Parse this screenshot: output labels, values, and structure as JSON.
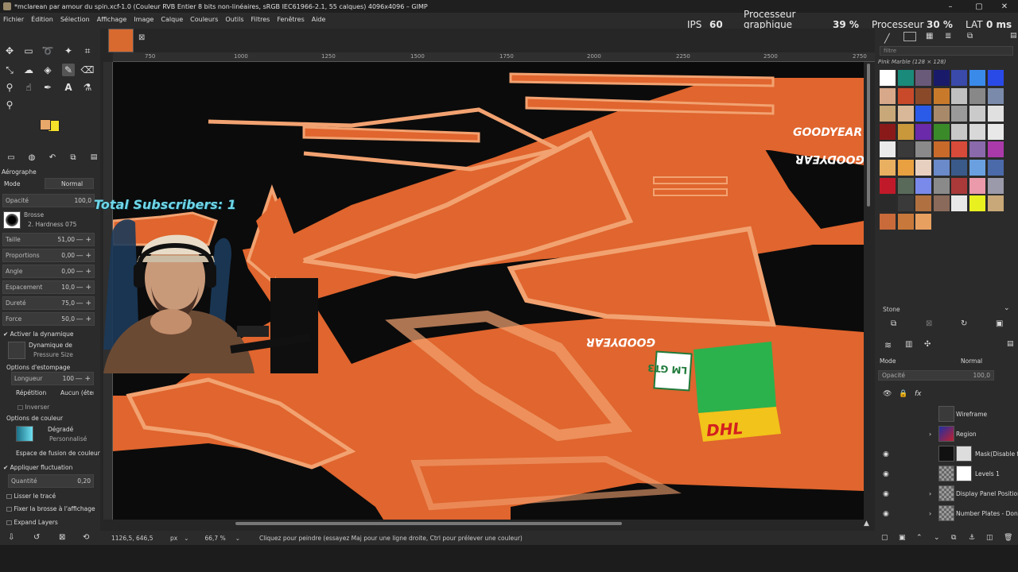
{
  "window": {
    "title": "*mclarean par amour du spin.xcf-1.0 (Couleur RVB Entier 8 bits non-linéaires, sRGB IEC61966-2.1, 55 calques) 4096x4096 – GIMP"
  },
  "menu": [
    "Fichier",
    "Édition",
    "Sélection",
    "Affichage",
    "Image",
    "Calque",
    "Couleurs",
    "Outils",
    "Filtres",
    "Fenêtres",
    "Aide"
  ],
  "overlay": {
    "fps_label": "IPS",
    "fps_value": "60",
    "gpu_label_1": "Processeur",
    "gpu_label_2": "graphique",
    "gpu_value": "39 %",
    "cpu_label": "Processeur",
    "cpu_value": "30 %",
    "lat_label": "LAT",
    "lat_value": "0 ms"
  },
  "ruler": {
    "ticks": [
      "750",
      "1000",
      "1250",
      "1500",
      "1750",
      "2000",
      "2250",
      "2500",
      "2750"
    ]
  },
  "tool_options": {
    "tool_name": "Aérographe",
    "mode_label": "Mode",
    "mode_value": "Normal",
    "opacity_label": "Opacité",
    "opacity_value": "100,0",
    "brush_label": "Brosse",
    "brush_value": "2. Hardness 075",
    "size_label": "Taille",
    "size_value": "51,00",
    "ratio_label": "Proportions",
    "ratio_value": "0,00",
    "angle_label": "Angle",
    "angle_value": "0,00",
    "spacing_label": "Espacement",
    "spacing_value": "10,0",
    "hardness_label": "Dureté",
    "hardness_value": "75,0",
    "force_label": "Force",
    "force_value": "50,0",
    "dynamics_toggle": "Activer la dynamique",
    "dynamics_label": "Dynamique de",
    "dynamics_value": "Pressure Size",
    "fade_options": "Options d'estompage",
    "length_label": "Longueur",
    "length_value": "100",
    "repeat_label": "Répétition",
    "repeat_value": "Aucun (étendre)",
    "invert_label": "Inverser",
    "color_options": "Options de couleur",
    "gradient_label": "Dégradé",
    "gradient_value": "Personnalisé",
    "blend_space": "Espace de fusion de couleur",
    "jitter_toggle": "Appliquer fluctuation",
    "amount_label": "Quantité",
    "amount_value": "0,20",
    "smooth_label": "Lisser le tracé",
    "lock_brush_label": "Fixer la brosse à l'affichage",
    "expand_layers": "Expand Layers"
  },
  "status": {
    "coords": "1126,5, 646,5",
    "unit": "px",
    "zoom": "66,7 %",
    "message": "Cliquez pour peindre (essayez Maj pour une ligne droite, Ctrl pour prélever une couleur)"
  },
  "canvas_text": {
    "goodyear": "GOODYEAR",
    "lm": "LM GT3",
    "dhl": "DHL"
  },
  "patterns": {
    "filter_placeholder": "filtre",
    "selected_name": "Pink Marble (128 × 128)",
    "tag_name": "Stone"
  },
  "layers": {
    "mode_label": "Mode",
    "mode_value": "Normal",
    "opacity_label": "Opacité",
    "opacity_value": "100,0",
    "items": [
      "Wireframe",
      "Region",
      "Mask(Disable for",
      "Levels 1",
      "Display Panel Position",
      "Number Plates - Don't"
    ]
  },
  "webcam": {
    "subscribers": "Total Subscribers: 1"
  },
  "colors": {
    "canvas_orange": "#e0652e",
    "stroke_light": "#f2a271",
    "black": "#0b0b0b",
    "fg_color": "#e8a86a",
    "bg_color": "#f5e12a"
  }
}
